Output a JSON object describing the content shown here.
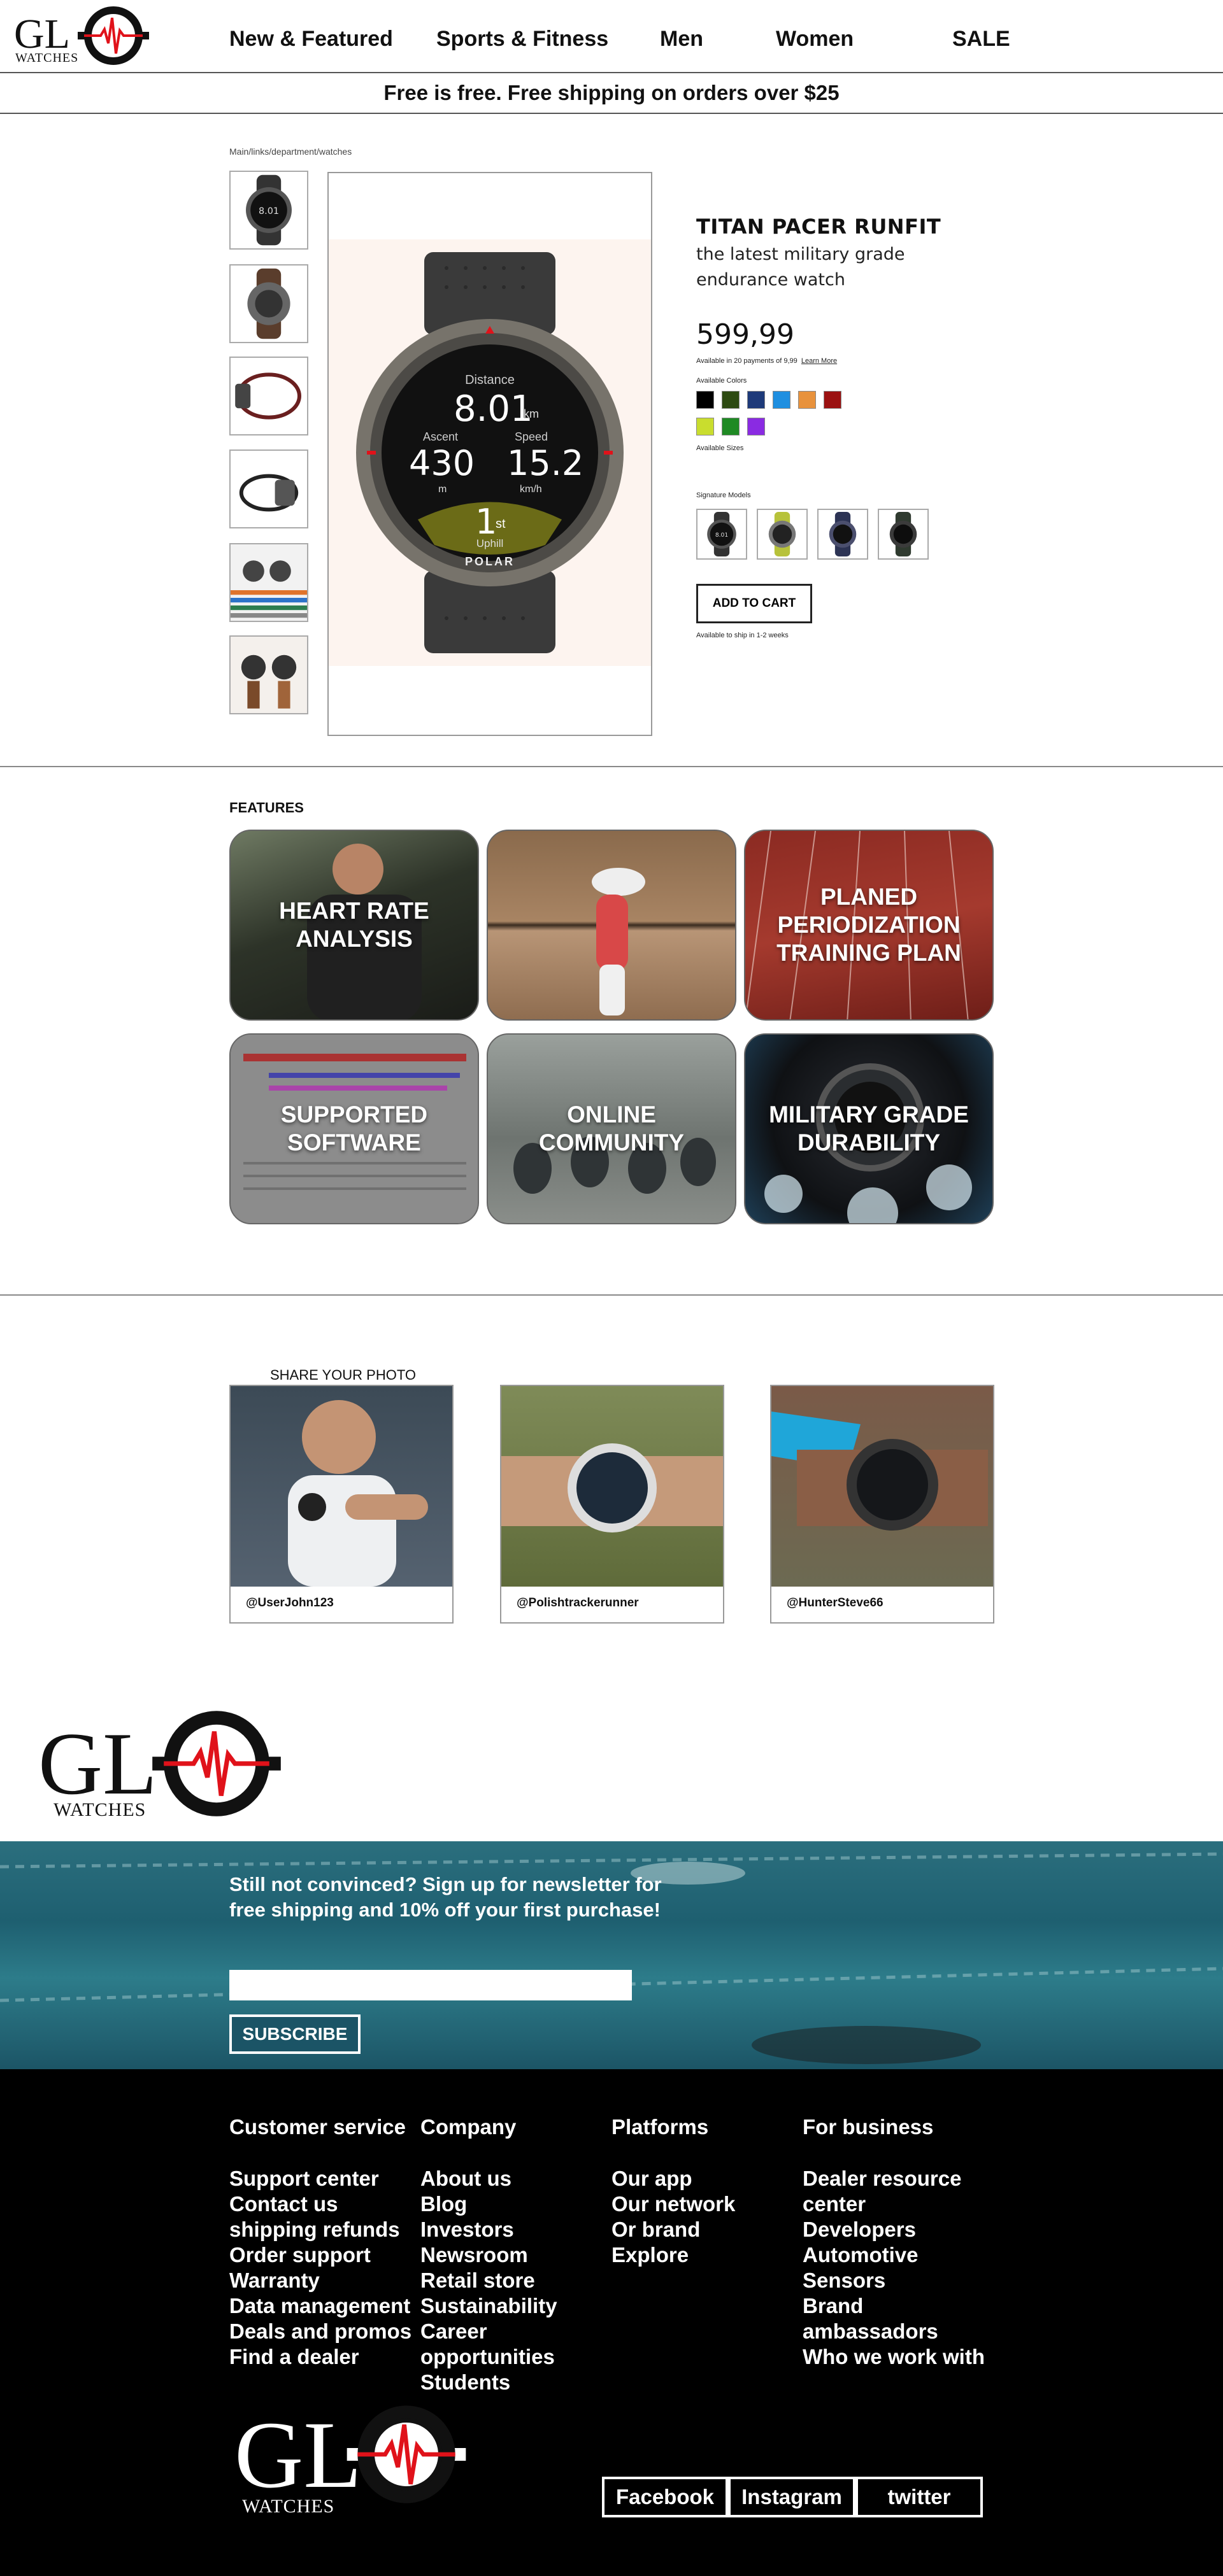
{
  "brand": {
    "logo_main": "GL",
    "logo_sub": "WATCHES",
    "accent": "#e0121a"
  },
  "nav": {
    "items": [
      {
        "label": "New & Featured"
      },
      {
        "label": "Sports & Fitness"
      },
      {
        "label": "Men"
      },
      {
        "label": "Women"
      },
      {
        "label": "SALE"
      }
    ]
  },
  "promo": {
    "text": "Free is free. Free shipping on orders over $25"
  },
  "product": {
    "breadcrumb": "Main/links/department/watches",
    "title": "TITAN PACER RUNFIT",
    "subtitle": "the latest military grade endurance watch",
    "price": "599,99",
    "installments": "Available in 20 payments of 9,99",
    "learn_more": "Learn More",
    "colors_label": "Available Colors",
    "colors": [
      "#000000",
      "#2d4a12",
      "#1e3a7a",
      "#1f8fe0",
      "#e8923c",
      "#9b1111",
      "#c9dd2e",
      "#1f8a24",
      "#8a2be2"
    ],
    "sizes_label": "Available Sizes",
    "models_label": "Signature Models",
    "add_to_cart": "ADD TO CART",
    "shipping": "Available to ship in 1-2 weeks",
    "watch_face": {
      "distance_label": "Distance",
      "distance": "8.01",
      "distance_unit": "km",
      "ascent_label": "Ascent",
      "ascent": "430",
      "ascent_unit": "m",
      "speed_label": "Speed",
      "speed": "15.2",
      "speed_unit": "km/h",
      "place": "1",
      "place_suffix": "st",
      "uphill": "Uphill",
      "brand": "POLAR"
    }
  },
  "features": {
    "heading": "FEATURES",
    "items": [
      {
        "label": "HEART RATE ANALYSIS"
      },
      {
        "label": ""
      },
      {
        "label": "PLANED PERIODIZATION TRAINING PLAN"
      },
      {
        "label": "SUPPORTED SOFTWARE"
      },
      {
        "label": "ONLINE COMMUNITY"
      },
      {
        "label": "MILITARY GRADE DURABILITY"
      }
    ]
  },
  "share": {
    "heading": "SHARE YOUR PHOTO",
    "items": [
      {
        "handle": "@UserJohn123"
      },
      {
        "handle": "@Polishtrackerunner"
      },
      {
        "handle": "@HunterSteve66"
      }
    ]
  },
  "newsletter": {
    "text": "Still not convinced? Sign up for newsletter for free shipping and 10% off your first purchase!",
    "button": "SUBSCRIBE"
  },
  "footer": {
    "columns": [
      {
        "heading": "Customer service",
        "links": [
          "Support center",
          "Contact us",
          "shipping refunds",
          "Order support",
          "Warranty",
          "Data management",
          "Deals and promos",
          "Find a dealer"
        ]
      },
      {
        "heading": "Company",
        "links": [
          "About us",
          "Blog",
          "Investors",
          "Newsroom",
          "Retail store",
          "Sustainability",
          "Career opportunities",
          "Students"
        ]
      },
      {
        "heading": "Platforms",
        "links": [
          "Our app",
          "Our network",
          "Or brand",
          "Explore"
        ]
      },
      {
        "heading": "For business",
        "links": [
          "Dealer resource center",
          "Developers",
          "Automotive",
          "Sensors",
          "Brand ambassadors",
          "Who we work with"
        ]
      }
    ],
    "social": [
      "Facebook",
      "Instagram",
      "twitter"
    ]
  }
}
